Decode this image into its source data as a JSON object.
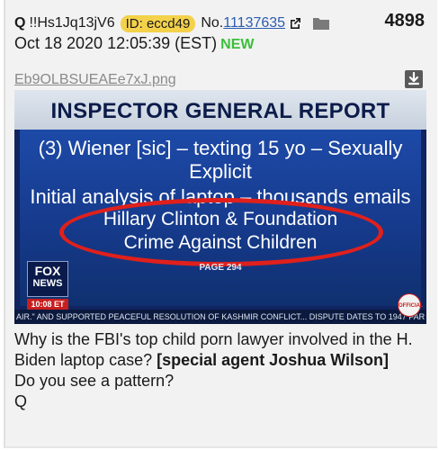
{
  "header": {
    "author": "Q",
    "trip": "!!Hs1Jq13jV6",
    "id_badge": "ID: eccd49",
    "no_prefix": "No.",
    "post_number": "11137635",
    "post_count": "4898",
    "timestamp": "Oct 18 2020 12:05:39 (EST)",
    "new_tag": "NEW",
    "icons": [
      "external-link-icon",
      "folder-icon"
    ]
  },
  "attachment": {
    "filename": "Eb9OLBSUEAEe7xJ.png",
    "download_icon": "download-icon",
    "image_text": {
      "title": "INSPECTOR GENERAL REPORT",
      "line1": "(3) Wiener [sic] – texting 15 yo – Sexually",
      "line2": "Explicit",
      "line3": "Initial analysis of laptop – thousands emails",
      "line4": "Hillary Clinton & Foundation",
      "line5": "Crime Against Children",
      "page": "PAGE 294",
      "fox_logo": "FOX",
      "fox_news": "NEWS",
      "fox_time": "10:08 ET",
      "ticker": "AIR.\" AND SUPPORTED PEACEFUL RESOLUTION OF KASHMIR CONFLICT...   DISPUTE DATES TO 1947 PAR",
      "official": "OFFICIAL"
    }
  },
  "message": {
    "line1": "Why is the FBI's top child porn lawyer involved in the H. Biden laptop case?",
    "bold": "[special agent Joshua Wilson]",
    "line2": "Do you see a pattern?",
    "signature": "Q"
  },
  "colors": {
    "id_badge_bg": "#f3d14a",
    "link": "#2a5db0",
    "new": "#3bbf3b",
    "circle": "#e0201c"
  }
}
